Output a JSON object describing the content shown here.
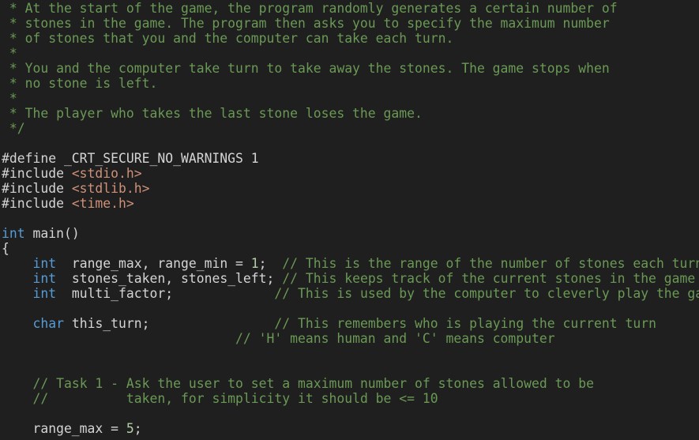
{
  "editor": {
    "language": "c",
    "theme": "dark-plus",
    "colors": {
      "background": "#1f1f1f",
      "foreground": "#d4d4d4",
      "comment": "#6a9955",
      "keyword": "#569cd6",
      "string": "#ce9178",
      "number": "#b5cea8"
    },
    "lines": [
      {
        "id": 1,
        "tokens": [
          {
            "t": "cmt",
            "s": " * At the start of the game, the program randomly generates a certain number of"
          }
        ]
      },
      {
        "id": 2,
        "tokens": [
          {
            "t": "cmt",
            "s": " * stones in the game. The program then asks you to specify the maximum number"
          }
        ]
      },
      {
        "id": 3,
        "tokens": [
          {
            "t": "cmt",
            "s": " * of stones that you and the computer can take each turn."
          }
        ]
      },
      {
        "id": 4,
        "tokens": [
          {
            "t": "cmt",
            "s": " *"
          }
        ]
      },
      {
        "id": 5,
        "tokens": [
          {
            "t": "cmt",
            "s": " * You and the computer take turn to take away the stones. The game stops when"
          }
        ]
      },
      {
        "id": 6,
        "tokens": [
          {
            "t": "cmt",
            "s": " * no stone is left."
          }
        ]
      },
      {
        "id": 7,
        "tokens": [
          {
            "t": "cmt",
            "s": " *"
          }
        ]
      },
      {
        "id": 8,
        "tokens": [
          {
            "t": "cmt",
            "s": " * The player who takes the last stone loses the game."
          }
        ]
      },
      {
        "id": 9,
        "tokens": [
          {
            "t": "cmt",
            "s": " */"
          }
        ]
      },
      {
        "id": 10,
        "tokens": []
      },
      {
        "id": 11,
        "tokens": [
          {
            "t": "pre",
            "s": "#define _CRT_SECURE_NO_WARNINGS 1"
          }
        ]
      },
      {
        "id": 12,
        "tokens": [
          {
            "t": "pre",
            "s": "#include "
          },
          {
            "t": "str",
            "s": "<stdio.h>"
          }
        ]
      },
      {
        "id": 13,
        "tokens": [
          {
            "t": "pre",
            "s": "#include "
          },
          {
            "t": "str",
            "s": "<stdlib.h>"
          }
        ]
      },
      {
        "id": 14,
        "tokens": [
          {
            "t": "pre",
            "s": "#include "
          },
          {
            "t": "str",
            "s": "<time.h>"
          }
        ]
      },
      {
        "id": 15,
        "tokens": []
      },
      {
        "id": 16,
        "tokens": [
          {
            "t": "kw",
            "s": "int"
          },
          {
            "t": "pln",
            "s": " main()"
          }
        ]
      },
      {
        "id": 17,
        "tokens": [
          {
            "t": "pln",
            "s": "{"
          }
        ]
      },
      {
        "id": 18,
        "tokens": [
          {
            "t": "pln",
            "s": "    "
          },
          {
            "t": "kw",
            "s": "int"
          },
          {
            "t": "pln",
            "s": "  range_max, range_min = "
          },
          {
            "t": "num",
            "s": "1"
          },
          {
            "t": "pln",
            "s": ";  "
          },
          {
            "t": "cmt",
            "s": "// This is the range of the number of stones each turn can take"
          }
        ]
      },
      {
        "id": 19,
        "tokens": [
          {
            "t": "pln",
            "s": "    "
          },
          {
            "t": "kw",
            "s": "int"
          },
          {
            "t": "pln",
            "s": "  stones_taken, stones_left; "
          },
          {
            "t": "cmt",
            "s": "// This keeps track of the current stones in the game"
          }
        ]
      },
      {
        "id": 20,
        "tokens": [
          {
            "t": "pln",
            "s": "    "
          },
          {
            "t": "kw",
            "s": "int"
          },
          {
            "t": "pln",
            "s": "  multi_factor;             "
          },
          {
            "t": "cmt",
            "s": "// This is used by the computer to cleverly play the game"
          }
        ]
      },
      {
        "id": 21,
        "tokens": []
      },
      {
        "id": 22,
        "tokens": [
          {
            "t": "pln",
            "s": "    "
          },
          {
            "t": "kw",
            "s": "char"
          },
          {
            "t": "pln",
            "s": " this_turn;                "
          },
          {
            "t": "cmt",
            "s": "// This remembers who is playing the current turn"
          }
        ]
      },
      {
        "id": 23,
        "tokens": [
          {
            "t": "pln",
            "s": "                              "
          },
          {
            "t": "cmt",
            "s": "// 'H' means human and 'C' means computer"
          }
        ]
      },
      {
        "id": 24,
        "tokens": []
      },
      {
        "id": 25,
        "tokens": []
      },
      {
        "id": 26,
        "tokens": [
          {
            "t": "pln",
            "s": "    "
          },
          {
            "t": "cmt",
            "s": "// Task 1 - Ask the user to set a maximum number of stones allowed to be"
          }
        ]
      },
      {
        "id": 27,
        "tokens": [
          {
            "t": "pln",
            "s": "    "
          },
          {
            "t": "cmt",
            "s": "//          taken, for simplicity it should be <= 10"
          }
        ]
      },
      {
        "id": 28,
        "tokens": []
      },
      {
        "id": 29,
        "tokens": [
          {
            "t": "pln",
            "s": "    range_max = "
          },
          {
            "t": "num",
            "s": "5"
          },
          {
            "t": "pln",
            "s": ";"
          }
        ]
      }
    ]
  }
}
